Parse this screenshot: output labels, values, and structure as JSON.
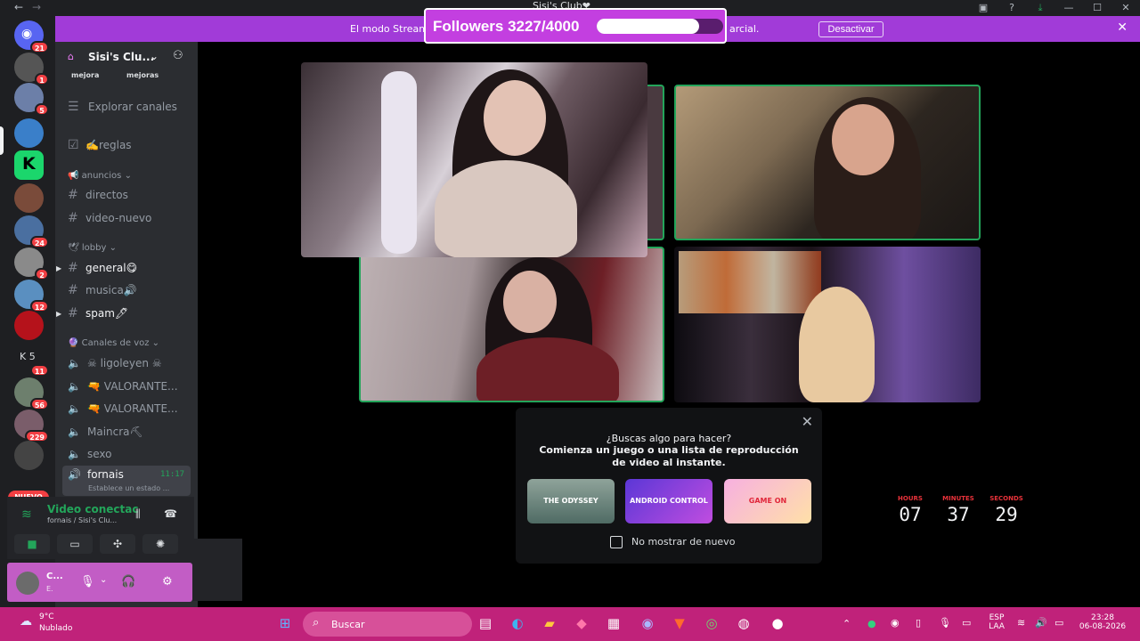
{
  "window": {
    "title": "Sisi's Club❤",
    "back": "←",
    "forward": "→"
  },
  "banner": {
    "text_left": "El modo Stream",
    "text_right": "arcial.",
    "button": "Desactivar",
    "close": "✕"
  },
  "followers_widget": {
    "label": "Followers 3227/4000",
    "progress": 0.807
  },
  "server_rail": {
    "badges": [
      "21",
      "1",
      "5",
      "24",
      "2",
      "12",
      "11",
      "56",
      "229"
    ],
    "k_label": "K 5",
    "new_label": "NUEVO"
  },
  "server": {
    "name": "Sisi's Clu...",
    "boost_left": "mejora",
    "boost_right": "mejoras"
  },
  "channels": {
    "explore": "Explorar canales",
    "rules": "✍️reglas",
    "cat_announcements": "📢 anuncios",
    "directos": "directos",
    "video_nuevo": "video-nuevo",
    "cat_lobby": "🕊 lobby",
    "general": "general😋",
    "musica": "musica🔊",
    "spam": "spam🖊",
    "cat_voice": "🔮 Canales de voz",
    "voice1": "☠ ligoleyen ☠",
    "voice2": "🔫 VALORANTE...",
    "voice3": "🔫 VALORANTE...",
    "voice4": "Maincra⛏",
    "voice5": "sexo",
    "voice6": "fornais",
    "voice6_time": "11:17",
    "voice6_status": "Establece un estado ..."
  },
  "voice_panel": {
    "status": "Video conectac",
    "sub": "fornais / Sisi's Clu..."
  },
  "user_panel": {
    "name": "C...",
    "status": "E."
  },
  "popup": {
    "title": "¿Buscas algo para hacer?",
    "subtitle": "Comienza un juego o una lista de reproducción de video al instante.",
    "activity1": "THE ODYSSEY",
    "activity2": "ANDROID CONTROL",
    "activity3": "GAME ON",
    "checkbox": "No mostrar de nuevo"
  },
  "countdown": {
    "hours_label": "HOURS",
    "hours": "07",
    "minutes_label": "MINUTES",
    "minutes": "37",
    "seconds_label": "SECONDS",
    "seconds": "29"
  },
  "taskbar": {
    "temp": "9°C",
    "condition": "Nublado",
    "search": "Buscar",
    "lang_top": "ESP",
    "lang_bottom": "LAA",
    "time": "23:28",
    "date": "06-08-2026"
  },
  "colors": {
    "banner": "#a13bd8",
    "followers_bg": "#c33fe0",
    "speaking": "#23a55a",
    "taskbar": "#c0227a",
    "countdown_label": "#e8323a"
  }
}
